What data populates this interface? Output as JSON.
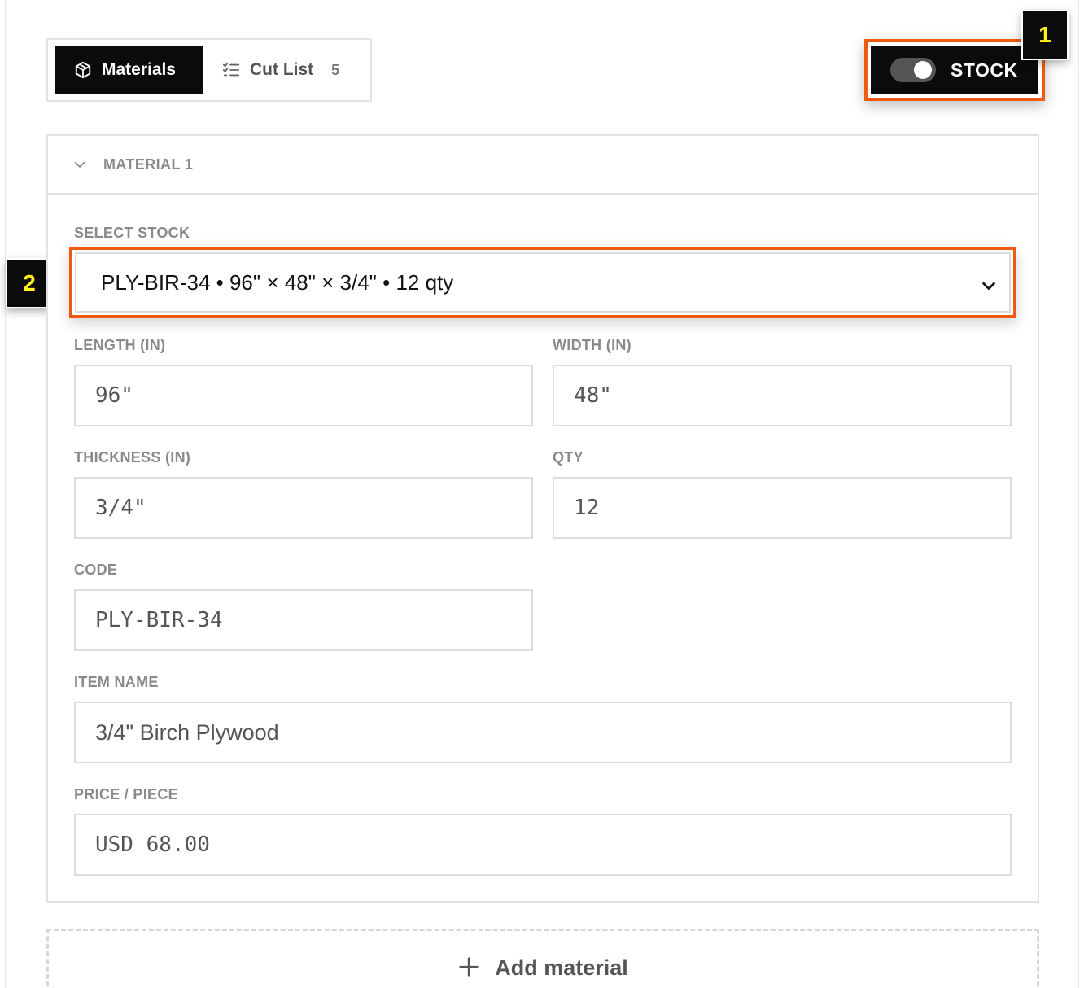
{
  "tabs": {
    "materials_label": "Materials",
    "cutlist_label": "Cut List",
    "cutlist_count": "5"
  },
  "stock_toggle": {
    "label": "STOCK",
    "on": true
  },
  "markers": [
    "1",
    "2"
  ],
  "material": {
    "header": "MATERIAL 1",
    "select_stock_label": "SELECT STOCK",
    "select_stock_value": "PLY-BIR-34 • 96\" × 48\" × 3/4\" • 12 qty",
    "length_label": "LENGTH (IN)",
    "length_value": "96\"",
    "width_label": "WIDTH (IN)",
    "width_value": "48\"",
    "thickness_label": "THICKNESS (IN)",
    "thickness_value": "3/4\"",
    "qty_label": "QTY",
    "qty_value": "12",
    "code_label": "CODE",
    "code_value": "PLY-BIR-34",
    "item_name_label": "ITEM NAME",
    "item_name_value": "3/4\" Birch Plywood",
    "price_label": "PRICE / PIECE",
    "price_value": "USD 68.00"
  },
  "add_material_label": "Add material",
  "colors": {
    "highlight": "#f05a0e",
    "marker_text": "#fff21f",
    "dark": "#0b0b0b"
  }
}
